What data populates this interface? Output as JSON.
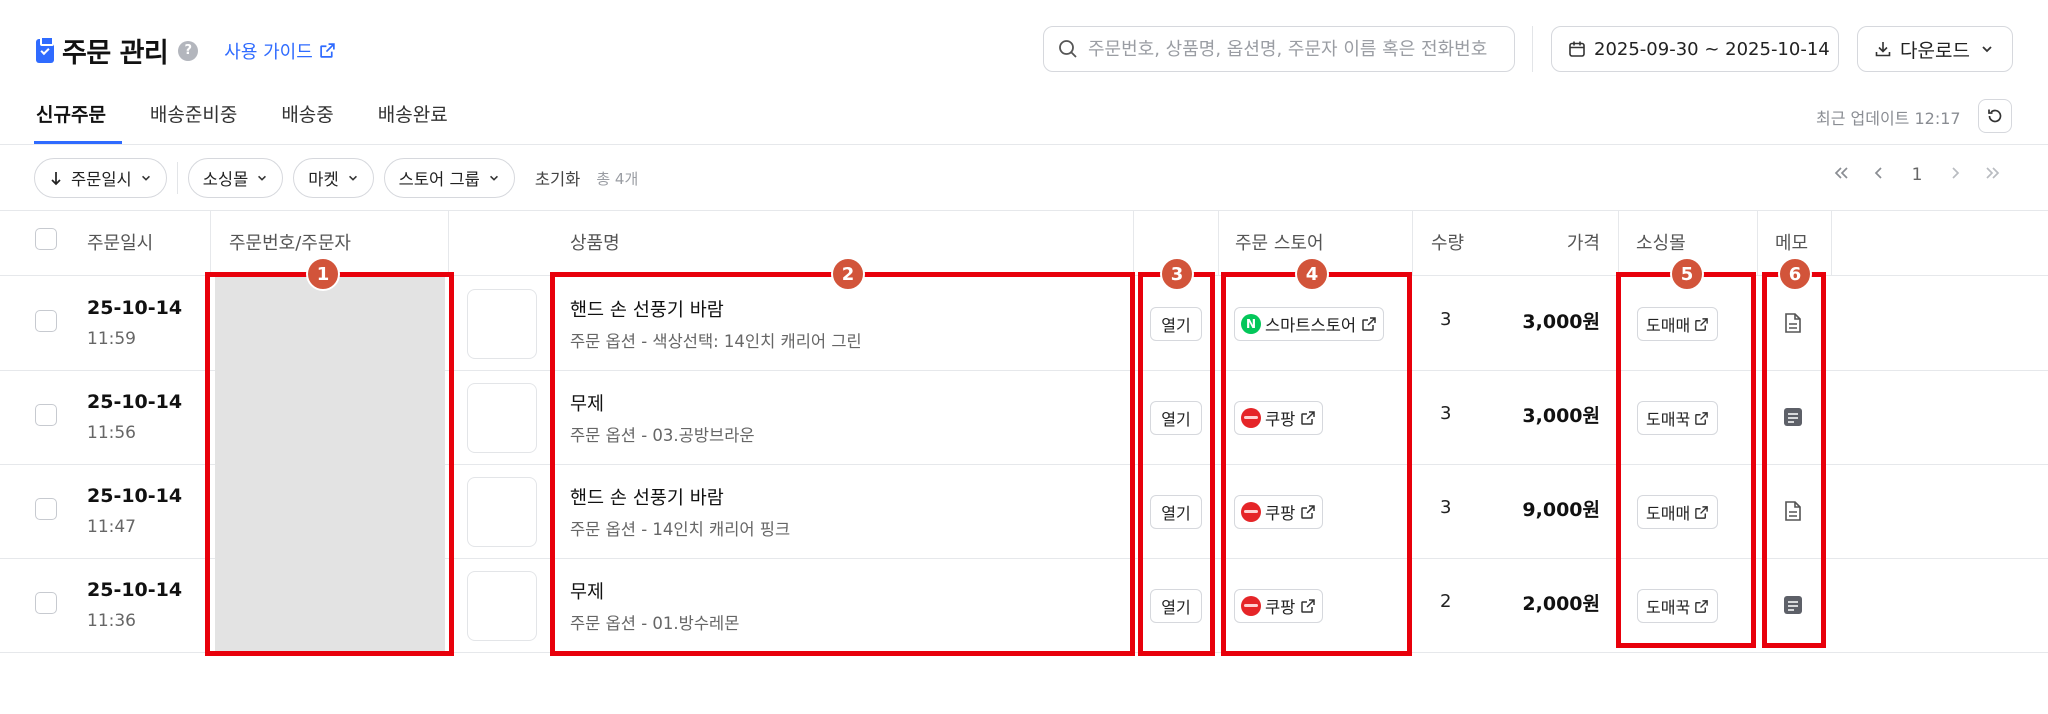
{
  "header": {
    "title": "주문 관리",
    "help_glyph": "?",
    "guide_label": "사용 가이드",
    "search_placeholder": "주문번호, 상품명, 옵션명, 주문자 이름 혹은 전화번호",
    "date_range": "2025-09-30 ~ 2025-10-14",
    "download_label": "다운로드"
  },
  "tabs": [
    {
      "label": "신규주문",
      "active": true
    },
    {
      "label": "배송준비중",
      "active": false
    },
    {
      "label": "배송중",
      "active": false
    },
    {
      "label": "배송완료",
      "active": false
    }
  ],
  "status": {
    "updated": "최근 업데이트 12:17"
  },
  "filters": {
    "sort": "주문일시",
    "mall": "소싱몰",
    "market": "마켓",
    "store_group": "스토어 그룹",
    "reset": "초기화",
    "total": "총 4개"
  },
  "pagination": {
    "current": "1"
  },
  "columns": {
    "date": "주문일시",
    "order": "주문번호/주문자",
    "product": "상품명",
    "store": "주문 스토어",
    "qty": "수량",
    "price": "가격",
    "mall": "소싱몰",
    "memo": "메모"
  },
  "rows": [
    {
      "date": "25-10-14",
      "time": "11:59",
      "product": "핸드 손 선풍기 바람",
      "option": "주문 옵션 - 색상선택: 14인치 캐리어 그린",
      "open": "열기",
      "store": "스마트스토어",
      "store_type": "naver",
      "qty": "3",
      "price": "3,000원",
      "mall": "도매매",
      "memo": "outline"
    },
    {
      "date": "25-10-14",
      "time": "11:56",
      "product": "무제",
      "option": "주문 옵션 - 03.공방브라운",
      "open": "열기",
      "store": "쿠팡",
      "store_type": "coupang",
      "qty": "3",
      "price": "3,000원",
      "mall": "도매꾹",
      "memo": "filled"
    },
    {
      "date": "25-10-14",
      "time": "11:47",
      "product": "핸드 손 선풍기 바람",
      "option": "주문 옵션 - 14인치 캐리어 핑크",
      "open": "열기",
      "store": "쿠팡",
      "store_type": "coupang",
      "qty": "3",
      "price": "9,000원",
      "mall": "도매매",
      "memo": "outline"
    },
    {
      "date": "25-10-14",
      "time": "11:36",
      "product": "무제",
      "option": "주문 옵션 - 01.방수레몬",
      "open": "열기",
      "store": "쿠팡",
      "store_type": "coupang",
      "qty": "2",
      "price": "2,000원",
      "mall": "도매꾹",
      "memo": "filled"
    }
  ],
  "annotations": [
    "1",
    "2",
    "3",
    "4",
    "5",
    "6"
  ],
  "colors": {
    "accent": "#2f6bff",
    "highlight": "#e8000b",
    "badge": "#d2543a",
    "naver": "#03c75a",
    "coupang": "#e52528"
  }
}
